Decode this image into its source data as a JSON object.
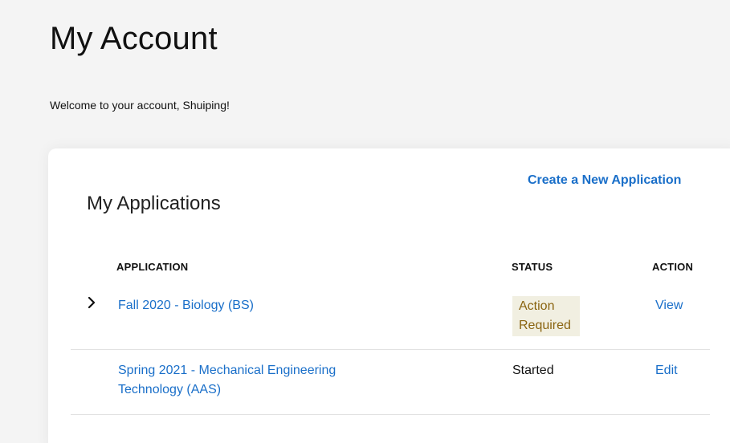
{
  "page": {
    "title": "My Account",
    "welcome": "Welcome to your account, Shuiping!"
  },
  "applications": {
    "create_link": "Create a New Application",
    "section_title": "My Applications",
    "columns": {
      "application": "APPLICATION",
      "status": "STATUS",
      "action": "ACTION"
    },
    "rows": [
      {
        "name": "Fall 2020 - Biology (BS)",
        "status": "Action Required",
        "action": "View",
        "expand_icon": "chevron-right-icon"
      },
      {
        "name": "Spring 2021 - Mechanical Engineering Technology (AAS)",
        "status": "Started",
        "action": "Edit"
      }
    ]
  },
  "colors": {
    "link": "#1a6fc9",
    "status_warning_text": "#8a6410",
    "status_warning_bg": "#f1efe1",
    "page_bg": "#f4f4f4"
  }
}
